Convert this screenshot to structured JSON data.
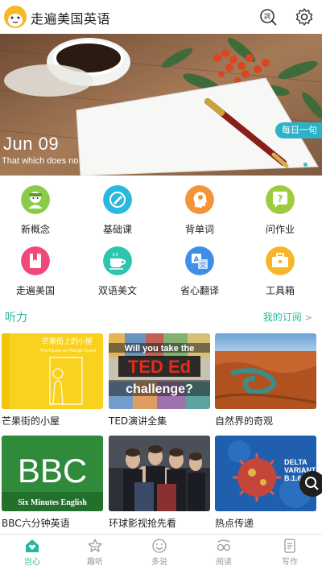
{
  "header": {
    "app_title": "走遍美国英语",
    "logo": "fox-avatar-icon",
    "icons": [
      "dictionary-search-icon",
      "gear-icon"
    ]
  },
  "banner": {
    "date": "Jun 09",
    "quote": "That which does no",
    "badge": "每日一句"
  },
  "grid": [
    {
      "label": "新概念",
      "icon": "person-icon",
      "color": "#8ccb4a"
    },
    {
      "label": "基础课",
      "icon": "book-icon",
      "color": "#2ab8df"
    },
    {
      "label": "背单词",
      "icon": "head-icon",
      "color": "#f29538"
    },
    {
      "label": "问作业",
      "icon": "question-icon",
      "color": "#9ccc3e"
    },
    {
      "label": "走遍美国",
      "icon": "bookmark-icon",
      "color": "#f2487a"
    },
    {
      "label": "双语美文",
      "icon": "coffee-icon",
      "color": "#2ec4b0"
    },
    {
      "label": "省心翻译",
      "icon": "translate-icon",
      "color": "#3f8ee8"
    },
    {
      "label": "工具箱",
      "icon": "toolbox-icon",
      "color": "#f7b52c"
    }
  ],
  "listening": {
    "title": "听力",
    "link": "我的订阅",
    "cards": [
      {
        "title": "芒果街的小屋",
        "thumb_text": "芒果街上的小屋",
        "thumb_sub": "The House on Mango Street"
      },
      {
        "title": "TED演讲全集",
        "thumb_text": "Will you take the",
        "thumb_sub": "challenge?",
        "thumb_logo": "TED Ed"
      },
      {
        "title": "自然界的奇观"
      },
      {
        "title": "BBC六分钟英语",
        "thumb_text": "BBC",
        "thumb_sub": "Six Minutes English"
      },
      {
        "title": "环球影视抢先看"
      },
      {
        "title": "热点传递",
        "thumb_text": "DELTA VARIANT B.1.617"
      }
    ]
  },
  "bottom_nav": [
    {
      "label": "岂心",
      "icon": "home-heart-icon",
      "active": true
    },
    {
      "label": "趣听",
      "icon": "star-icon",
      "active": false
    },
    {
      "label": "多说",
      "icon": "smile-icon",
      "active": false
    },
    {
      "label": "阅读",
      "icon": "glasses-icon",
      "active": false
    },
    {
      "label": "写作",
      "icon": "notebook-icon",
      "active": false
    }
  ]
}
